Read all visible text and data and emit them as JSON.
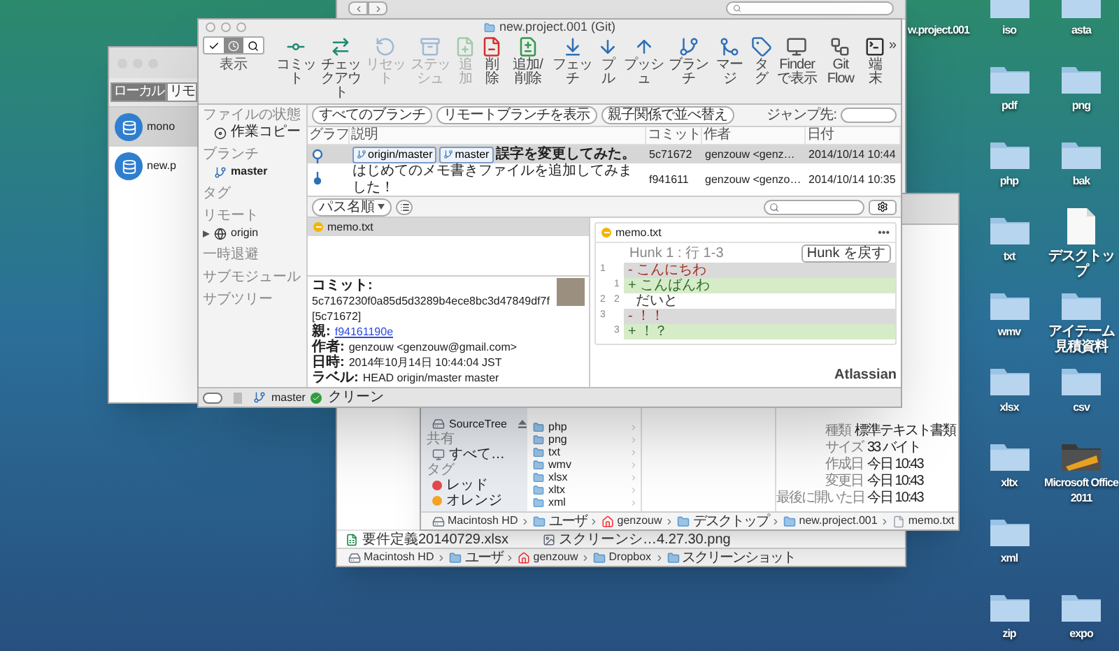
{
  "desktop": {
    "columns": [
      {
        "icons": [
          {
            "label": "w.project.001",
            "kind": "label"
          }
        ]
      },
      {
        "icons": [
          {
            "label": "iso",
            "kind": "folder"
          },
          {
            "label": "pdf",
            "kind": "folder"
          },
          {
            "label": "php",
            "kind": "folder"
          },
          {
            "label": "txt",
            "kind": "folder"
          },
          {
            "label": "wmv",
            "kind": "folder"
          },
          {
            "label": "xlsx",
            "kind": "folder"
          },
          {
            "label": "xltx",
            "kind": "folder"
          },
          {
            "label": "xml",
            "kind": "folder"
          },
          {
            "label": "zip",
            "kind": "folder"
          }
        ]
      },
      {
        "icons": [
          {
            "label": "asta",
            "kind": "folder"
          },
          {
            "label": "png",
            "kind": "folder"
          },
          {
            "label": "bak",
            "kind": "folder"
          },
          {
            "label": "デスクトップ",
            "kind": "document"
          },
          {
            "label": "アイテーム見積資料",
            "kind": "folder"
          },
          {
            "label": "csv",
            "kind": "folder"
          },
          {
            "label": "Microsoft Office 2011",
            "kind": "app"
          },
          {
            "label": "expo",
            "kind": "folder"
          }
        ]
      }
    ]
  },
  "finder_back": {
    "files": [
      {
        "name": "要件定義20140729.xlsx",
        "kind": "spreadsheet"
      },
      {
        "name": "スクリーンシ…4.27.30.png",
        "kind": "image"
      }
    ],
    "path": [
      {
        "label": "Macintosh HD",
        "kind": "disk"
      },
      {
        "label": "ユーザ",
        "kind": "folder"
      },
      {
        "label": "genzouw",
        "kind": "home"
      },
      {
        "label": "Dropbox",
        "kind": "folder"
      },
      {
        "label": "スクリーンショット",
        "kind": "folder"
      }
    ]
  },
  "finder_front": {
    "sidebar": [
      {
        "label": "SourceTree",
        "kind": "device"
      },
      {
        "label": "共有",
        "kind": "header"
      },
      {
        "label": "すべて…",
        "kind": "network"
      },
      {
        "label": "タグ",
        "kind": "header"
      },
      {
        "label": "レッド",
        "kind": "tag",
        "color": "#e5484d"
      },
      {
        "label": "オレンジ",
        "kind": "tag",
        "color": "#f5a524"
      }
    ],
    "folders": [
      "php",
      "png",
      "txt",
      "wmv",
      "xlsx",
      "xltx",
      "xml"
    ],
    "info": [
      {
        "label": "種類",
        "value": "標準テキスト書類"
      },
      {
        "label": "サイズ",
        "value": "33 バイト"
      },
      {
        "label": "作成日",
        "value": "今日 10:43"
      },
      {
        "label": "変更日",
        "value": "今日 10:43"
      },
      {
        "label": "最後に開いた日",
        "value": "今日 10:43"
      }
    ],
    "path": [
      {
        "label": "Macintosh HD",
        "kind": "disk"
      },
      {
        "label": "ユーザ",
        "kind": "folder"
      },
      {
        "label": "genzouw",
        "kind": "home"
      },
      {
        "label": "デスクトップ",
        "kind": "folder"
      },
      {
        "label": "new.project.001",
        "kind": "folder"
      },
      {
        "label": "memo.txt",
        "kind": "file"
      }
    ]
  },
  "bookmarks": {
    "tabs": [
      {
        "label": "ローカル",
        "selected": true
      },
      {
        "label": "リモ",
        "selected": false
      }
    ],
    "repos": [
      {
        "name": "mono",
        "selected": true
      },
      {
        "name": "new.p",
        "selected": false
      }
    ]
  },
  "main_window": {
    "title": "new.project.001 (Git)",
    "view_label": "表示",
    "toolbar": [
      {
        "label": "コミット",
        "kind": "commit",
        "disabled": false
      },
      {
        "label": "チェックアウト",
        "kind": "checkout",
        "disabled": false
      },
      {
        "label": "リセット",
        "kind": "reset",
        "disabled": true
      },
      {
        "label": "ステッシュ",
        "kind": "stash",
        "disabled": true
      },
      {
        "label": "追加",
        "kind": "add",
        "disabled": true
      },
      {
        "label": "削除",
        "kind": "remove",
        "disabled": false
      },
      {
        "label": "追加/削除",
        "kind": "addremove",
        "disabled": false
      },
      {
        "label": "フェッチ",
        "kind": "fetch",
        "disabled": false
      },
      {
        "label": "プル",
        "kind": "pull",
        "disabled": false
      },
      {
        "label": "プッシュ",
        "kind": "push",
        "disabled": false
      },
      {
        "label": "ブランチ",
        "kind": "branch",
        "disabled": false
      },
      {
        "label": "マージ",
        "kind": "merge",
        "disabled": false
      },
      {
        "label": "タグ",
        "kind": "tag",
        "disabled": false
      },
      {
        "label": "Finder で表示",
        "kind": "finder",
        "disabled": false
      },
      {
        "label": "Git Flow",
        "kind": "gitflow",
        "disabled": false
      },
      {
        "label": "端末",
        "kind": "terminal",
        "disabled": false
      }
    ],
    "overflow": "»",
    "sidebar": [
      {
        "title": "ファイルの状態",
        "items": [
          {
            "label": "作業コピー",
            "kind": "working_copy"
          }
        ]
      },
      {
        "title": "ブランチ",
        "items": [
          {
            "label": "master",
            "kind": "branch",
            "current": true
          }
        ]
      },
      {
        "title": "タグ"
      },
      {
        "title": "リモート",
        "items": [
          {
            "label": "origin",
            "kind": "remote",
            "expanded": false
          }
        ]
      },
      {
        "title": "一時退避"
      },
      {
        "title": "サブモジュール"
      },
      {
        "title": "サブツリー"
      }
    ],
    "filters": [
      "すべてのブランチ",
      "リモートブランチを表示",
      "親子関係で並べ替え"
    ],
    "jump_label": "ジャンプ先:",
    "table": {
      "columns": [
        "グラフ",
        "説明",
        "コミット",
        "作者",
        "日付"
      ],
      "rows": [
        {
          "selected": true,
          "refs": [
            "origin/master",
            "master"
          ],
          "description": "誤字を変更してみた。",
          "commit": "5c71672",
          "author": "genzouw <genz…",
          "date": "2014/10/14 10:44"
        },
        {
          "selected": false,
          "description": "はじめてのメモ書きファイルを追加してみました！",
          "commit": "f941611",
          "author": "genzouw <genzo…",
          "date": "2014/10/14 10:35"
        }
      ]
    },
    "file_list": {
      "sort": "パス名順",
      "files": [
        {
          "name": "memo.txt",
          "selected": true
        }
      ]
    },
    "details": [
      {
        "label": "コミット:",
        "value": "5c7167230f0a85d5d3289b4ece8bc3d47849df7f [5c71672]"
      },
      {
        "label": "親:",
        "link": "f94161190e"
      },
      {
        "label": "作者:",
        "value": "genzouw <genzouw@gmail.com>"
      },
      {
        "label": "日時:",
        "value": "2014年10月14日 10:44:04 JST"
      },
      {
        "label": "ラベル:",
        "value": "HEAD origin/master master"
      }
    ],
    "diff": {
      "file": "memo.txt",
      "menu": "•••",
      "hunk_title": "Hunk 1 : 行 1-3",
      "hunk_button": "Hunk を戻す",
      "lines": [
        {
          "old": "1",
          "kind": "removed",
          "text": "- こんにちわ"
        },
        {
          "new": "1",
          "kind": "added",
          "text": "+ こんばんわ"
        },
        {
          "old": "2",
          "new": "2",
          "kind": "context",
          "text": "  だいと"
        },
        {
          "old": "3",
          "kind": "removed",
          "text": "- ！！"
        },
        {
          "new": "3",
          "kind": "added",
          "text": "+ ！？"
        }
      ]
    },
    "footer": "Atlassian",
    "status_bar": {
      "branch": "master",
      "state": "クリーン"
    }
  }
}
